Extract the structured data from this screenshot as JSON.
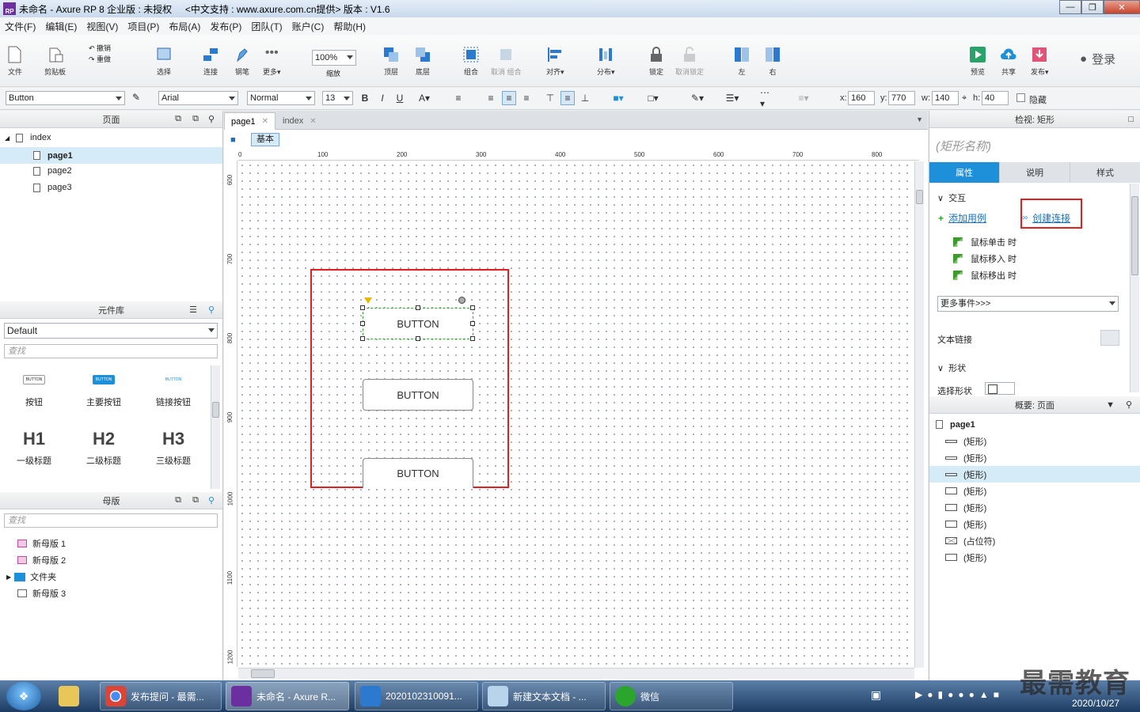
{
  "window": {
    "title": "未命名 - Axure RP 8 企业版 : 未授权     <中文支持 : www.axure.com.cn提供> 版本 : V1.6",
    "logo": "RP"
  },
  "menu": [
    "文件(F)",
    "编辑(E)",
    "视图(V)",
    "项目(P)",
    "布局(A)",
    "发布(P)",
    "团队(T)",
    "账户(C)",
    "帮助(H)"
  ],
  "toolbar": {
    "file": "文件",
    "clipboard": "剪贴板",
    "undo": "撤销",
    "redo": "重做",
    "select": "选择",
    "connect": "连接",
    "pen": "钢笔",
    "more": "更多▾",
    "zoom": "100%",
    "zoom_label": "缩放",
    "top": "顶层",
    "bottom": "底层",
    "group": "组合",
    "ungroup": "取消 组合",
    "align": "对齐▾",
    "distribute": "分布▾",
    "lock": "锁定",
    "unlock": "取消锁定",
    "left": "左",
    "right": "右",
    "preview": "预览",
    "share": "共享",
    "publish": "发布▾",
    "login": "登录"
  },
  "format": {
    "widget_type": "Button",
    "font": "Arial",
    "style": "Normal",
    "size": "13",
    "bold": "B",
    "italic": "I",
    "underline": "U",
    "x_label": "x:",
    "x": "160",
    "y_label": "y:",
    "y": "770",
    "w_label": "w:",
    "w": "140",
    "h_label": "h:",
    "h": "40",
    "hidden": "隐藏"
  },
  "pages_panel": {
    "title": "页面",
    "root": "index",
    "items": [
      "page1",
      "page2",
      "page3"
    ]
  },
  "library": {
    "title": "元件库",
    "selected": "Default",
    "search": "查找",
    "widgets": [
      "按钮",
      "主要按钮",
      "链接按钮",
      "一级标题",
      "二级标题",
      "三级标题"
    ],
    "widget_texts": [
      "BUTTON",
      "BUTTON",
      "BUTTON",
      "H1",
      "H2",
      "H3"
    ]
  },
  "masters": {
    "title": "母版",
    "search": "查找",
    "items": [
      "新母版 1",
      "新母版 2",
      "文件夹",
      "新母版 3"
    ]
  },
  "canvas": {
    "tabs": [
      "page1",
      "index"
    ],
    "adaptive": "基本",
    "ruler_h": [
      "0",
      "100",
      "200",
      "300",
      "400",
      "500",
      "600",
      "700",
      "800"
    ],
    "ruler_v": [
      "600",
      "700",
      "800",
      "900",
      "1000",
      "1100",
      "1200"
    ],
    "buttons": [
      "BUTTON",
      "BUTTON",
      "BUTTON"
    ]
  },
  "inspector": {
    "title": "检视: 矩形",
    "name_placeholder": "(矩形名称)",
    "tabs": [
      "属性",
      "说明",
      "样式"
    ],
    "interaction": "交互",
    "add_case": "添加用例",
    "create_link": "创建连接",
    "events": [
      "鼠标单击 时",
      "鼠标移入 时",
      "鼠标移出 时"
    ],
    "more_events": "更多事件>>>",
    "text_link": "文本链接",
    "shape": "形状",
    "select_shape": "选择形状"
  },
  "outline": {
    "title": "概要: 页面",
    "root": "page1",
    "items": [
      "(矩形)",
      "(矩形)",
      "(矩形)",
      "(矩形)",
      "(矩形)",
      "(矩形)",
      "(占位符)",
      "(矩形)"
    ]
  },
  "taskbar": {
    "tasks": [
      "发布提问 - 最需...",
      "未命名 - Axure R...",
      "2020102310091...",
      "新建文本文档 - ...",
      "微信"
    ],
    "time": "2020/10/27",
    "watermark": "最需教育"
  }
}
